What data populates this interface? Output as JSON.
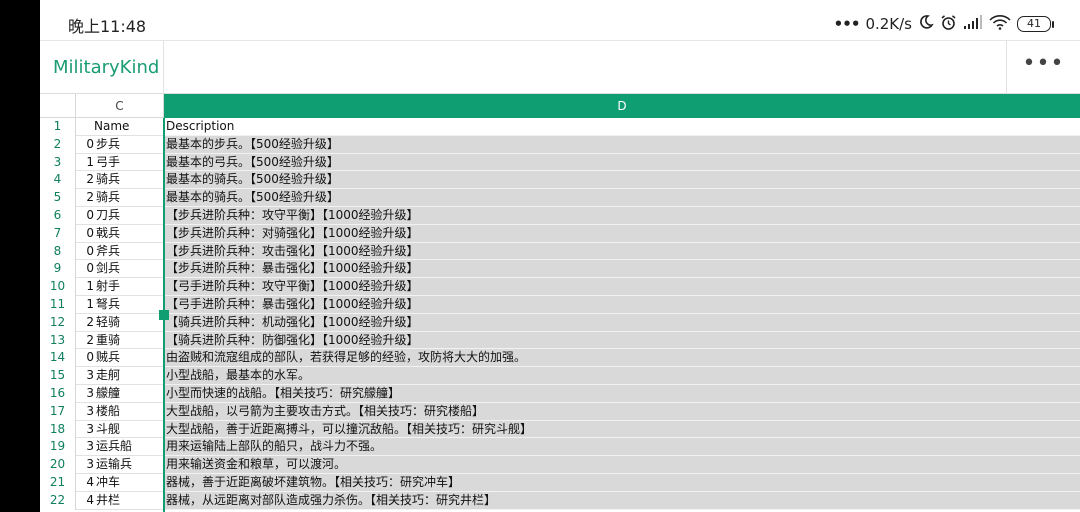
{
  "status_bar": {
    "time": "晚上11:48",
    "network_speed": "0.2K/s",
    "battery": "41",
    "icons": [
      "dots-icon",
      "moon-icon",
      "alarm-icon",
      "signal-icon",
      "wifi-icon",
      "battery-icon"
    ]
  },
  "app_bar": {
    "title": "MilitaryKind",
    "more_label": "•••"
  },
  "sheet": {
    "accent_color": "#0f9e72",
    "columns": {
      "c": "C",
      "d": "D"
    },
    "header_row": {
      "num": "1",
      "name": "Name",
      "description": "Description"
    },
    "rows": [
      {
        "num": "2",
        "kind": "0",
        "name": "步兵",
        "description": "最基本的步兵。【500经验升级】"
      },
      {
        "num": "3",
        "kind": "1",
        "name": "弓手",
        "description": "最基本的弓兵。【500经验升级】"
      },
      {
        "num": "4",
        "kind": "2",
        "name": "骑兵",
        "description": "最基本的骑兵。【500经验升级】"
      },
      {
        "num": "5",
        "kind": "2",
        "name": "骑兵",
        "description": "最基本的骑兵。【500经验升级】"
      },
      {
        "num": "6",
        "kind": "0",
        "name": "刀兵",
        "description": "【步兵进阶兵种：攻守平衡】【1000经验升级】"
      },
      {
        "num": "7",
        "kind": "0",
        "name": "戟兵",
        "description": "【步兵进阶兵种：对骑强化】【1000经验升级】"
      },
      {
        "num": "8",
        "kind": "0",
        "name": "斧兵",
        "description": "【步兵进阶兵种：攻击强化】【1000经验升级】"
      },
      {
        "num": "9",
        "kind": "0",
        "name": "剑兵",
        "description": "【步兵进阶兵种：暴击强化】【1000经验升级】"
      },
      {
        "num": "10",
        "kind": "1",
        "name": "射手",
        "description": "【弓手进阶兵种：攻守平衡】【1000经验升级】"
      },
      {
        "num": "11",
        "kind": "1",
        "name": "弩兵",
        "description": "【弓手进阶兵种：暴击强化】【1000经验升级】"
      },
      {
        "num": "12",
        "kind": "2",
        "name": "轻骑",
        "description": "【骑兵进阶兵种：机动强化】【1000经验升级】"
      },
      {
        "num": "13",
        "kind": "2",
        "name": "重骑",
        "description": "【骑兵进阶兵种：防御强化】【1000经验升级】"
      },
      {
        "num": "14",
        "kind": "0",
        "name": "贼兵",
        "description": "由盗贼和流寇组成的部队，若获得足够的经验，攻防将大大的加强。"
      },
      {
        "num": "15",
        "kind": "3",
        "name": "走舸",
        "description": "小型战船，最基本的水军。"
      },
      {
        "num": "16",
        "kind": "3",
        "name": "艨艟",
        "description": "小型而快速的战船。【相关技巧：研究艨艟】"
      },
      {
        "num": "17",
        "kind": "3",
        "name": "楼船",
        "description": "大型战船，以弓箭为主要攻击方式。【相关技巧：研究楼船】"
      },
      {
        "num": "18",
        "kind": "3",
        "name": "斗舰",
        "description": "大型战船，善于近距离搏斗，可以撞沉敌船。【相关技巧：研究斗舰】"
      },
      {
        "num": "19",
        "kind": "3",
        "name": "运兵船",
        "description": "用来运输陆上部队的船只，战斗力不强。"
      },
      {
        "num": "20",
        "kind": "3",
        "name": "运输兵",
        "description": "用来输送资金和粮草，可以渡河。"
      },
      {
        "num": "21",
        "kind": "4",
        "name": "冲车",
        "description": "器械，善于近距离破坏建筑物。【相关技巧：研究冲车】"
      },
      {
        "num": "22",
        "kind": "4",
        "name": "井栏",
        "description": "器械，从远距离对部队造成强力杀伤。【相关技巧：研究井栏】"
      }
    ]
  }
}
